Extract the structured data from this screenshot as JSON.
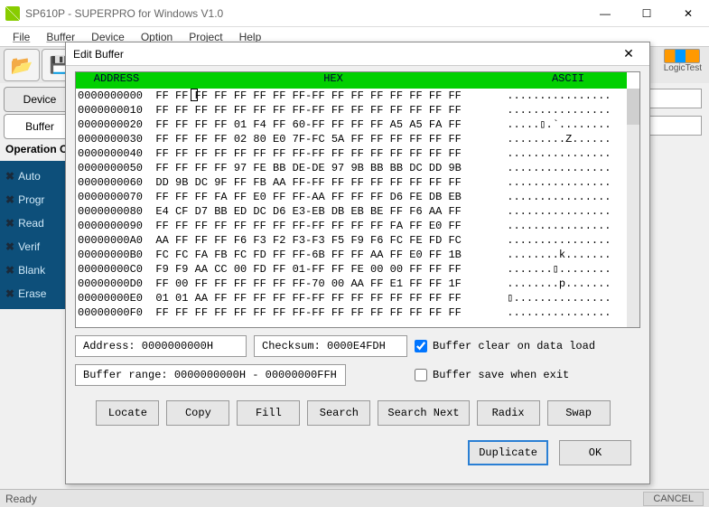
{
  "window": {
    "title": "SP610P - SUPERPRO for Windows V1.0",
    "min": "—",
    "max": "☐",
    "close": "✕"
  },
  "menu": [
    "File",
    "Buffer",
    "Device",
    "Option",
    "Project",
    "Help"
  ],
  "toolbar": {
    "logictest": "LogicTest"
  },
  "tabs": {
    "device": "Device",
    "buffer": "Buffer"
  },
  "op_label": "Operation O",
  "actions": [
    "Auto",
    "Progr",
    "Read",
    "Verif",
    "Blank",
    "Erase"
  ],
  "dialog": {
    "title": "Edit Buffer",
    "close": "✕",
    "headers": {
      "address": "ADDRESS",
      "hex": "HEX",
      "ascii": "ASCII"
    },
    "rows": [
      {
        "a": "0000000000",
        "h": "FF FF FF FF FF FF FF FF-FF FF FF FF FF FF FF FF",
        "s": "................"
      },
      {
        "a": "0000000010",
        "h": "FF FF FF FF FF FF FF FF-FF FF FF FF FF FF FF FF",
        "s": "................"
      },
      {
        "a": "0000000020",
        "h": "FF FF FF FF 01 F4 FF 60-FF FF FF FF A5 A5 FA FF",
        "s": ".....▯.`........"
      },
      {
        "a": "0000000030",
        "h": "FF FF FF FF 02 80 E0 7F-FC 5A FF FF FF FF FF FF",
        "s": ".........Z......"
      },
      {
        "a": "0000000040",
        "h": "FF FF FF FF FF FF FF FF-FF FF FF FF FF FF FF FF",
        "s": "................"
      },
      {
        "a": "0000000050",
        "h": "FF FF FF FF 97 FE BB DE-DE 97 9B BB BB DC DD 9B",
        "s": "................"
      },
      {
        "a": "0000000060",
        "h": "DD 9B DC 9F FF FB AA FF-FF FF FF FF FF FF FF FF",
        "s": "................"
      },
      {
        "a": "0000000070",
        "h": "FF FF FF FA FF E0 FF FF-AA FF FF FF D6 FE DB EB",
        "s": "................"
      },
      {
        "a": "0000000080",
        "h": "E4 CF D7 BB ED DC D6 E3-EB DB EB BE FF F6 AA FF",
        "s": "................"
      },
      {
        "a": "0000000090",
        "h": "FF FF FF FF FF FF FF FF-FF FF FF FF FA FF E0 FF",
        "s": "................"
      },
      {
        "a": "00000000A0",
        "h": "AA FF FF FF F6 F3 F2 F3-F3 F5 F9 F6 FC FE FD FC",
        "s": "................"
      },
      {
        "a": "00000000B0",
        "h": "FC FC FA FB FC FD FF FF-6B FF FF AA FF E0 FF 1B",
        "s": "........k......."
      },
      {
        "a": "00000000C0",
        "h": "F9 F9 AA CC 00 FD FF 01-FF FF FE 00 00 FF FF FF",
        "s": ".......▯........"
      },
      {
        "a": "00000000D0",
        "h": "FF 00 FF FF FF FF FF FF-70 00 AA FF E1 FF FF 1F",
        "s": "........p......."
      },
      {
        "a": "00000000E0",
        "h": "01 01 AA FF FF FF FF FF-FF FF FF FF FF FF FF FF",
        "s": "▯..............."
      },
      {
        "a": "00000000F0",
        "h": "FF FF FF FF FF FF FF FF-FF FF FF FF FF FF FF FF",
        "s": "................"
      }
    ],
    "address_label": "Address: 0000000000H",
    "checksum_label": "Checksum: 0000E4FDH",
    "range_label": "Buffer range: 0000000000H - 00000000FFH",
    "chk_clear": "Buffer clear on data load",
    "chk_save": "Buffer save when exit",
    "buttons": [
      "Locate",
      "Copy",
      "Fill",
      "Search",
      "Search Next",
      "Radix",
      "Swap"
    ],
    "duplicate": "Duplicate",
    "ok": "OK"
  },
  "status": {
    "ready": "Ready",
    "cancel": "CANCEL"
  }
}
